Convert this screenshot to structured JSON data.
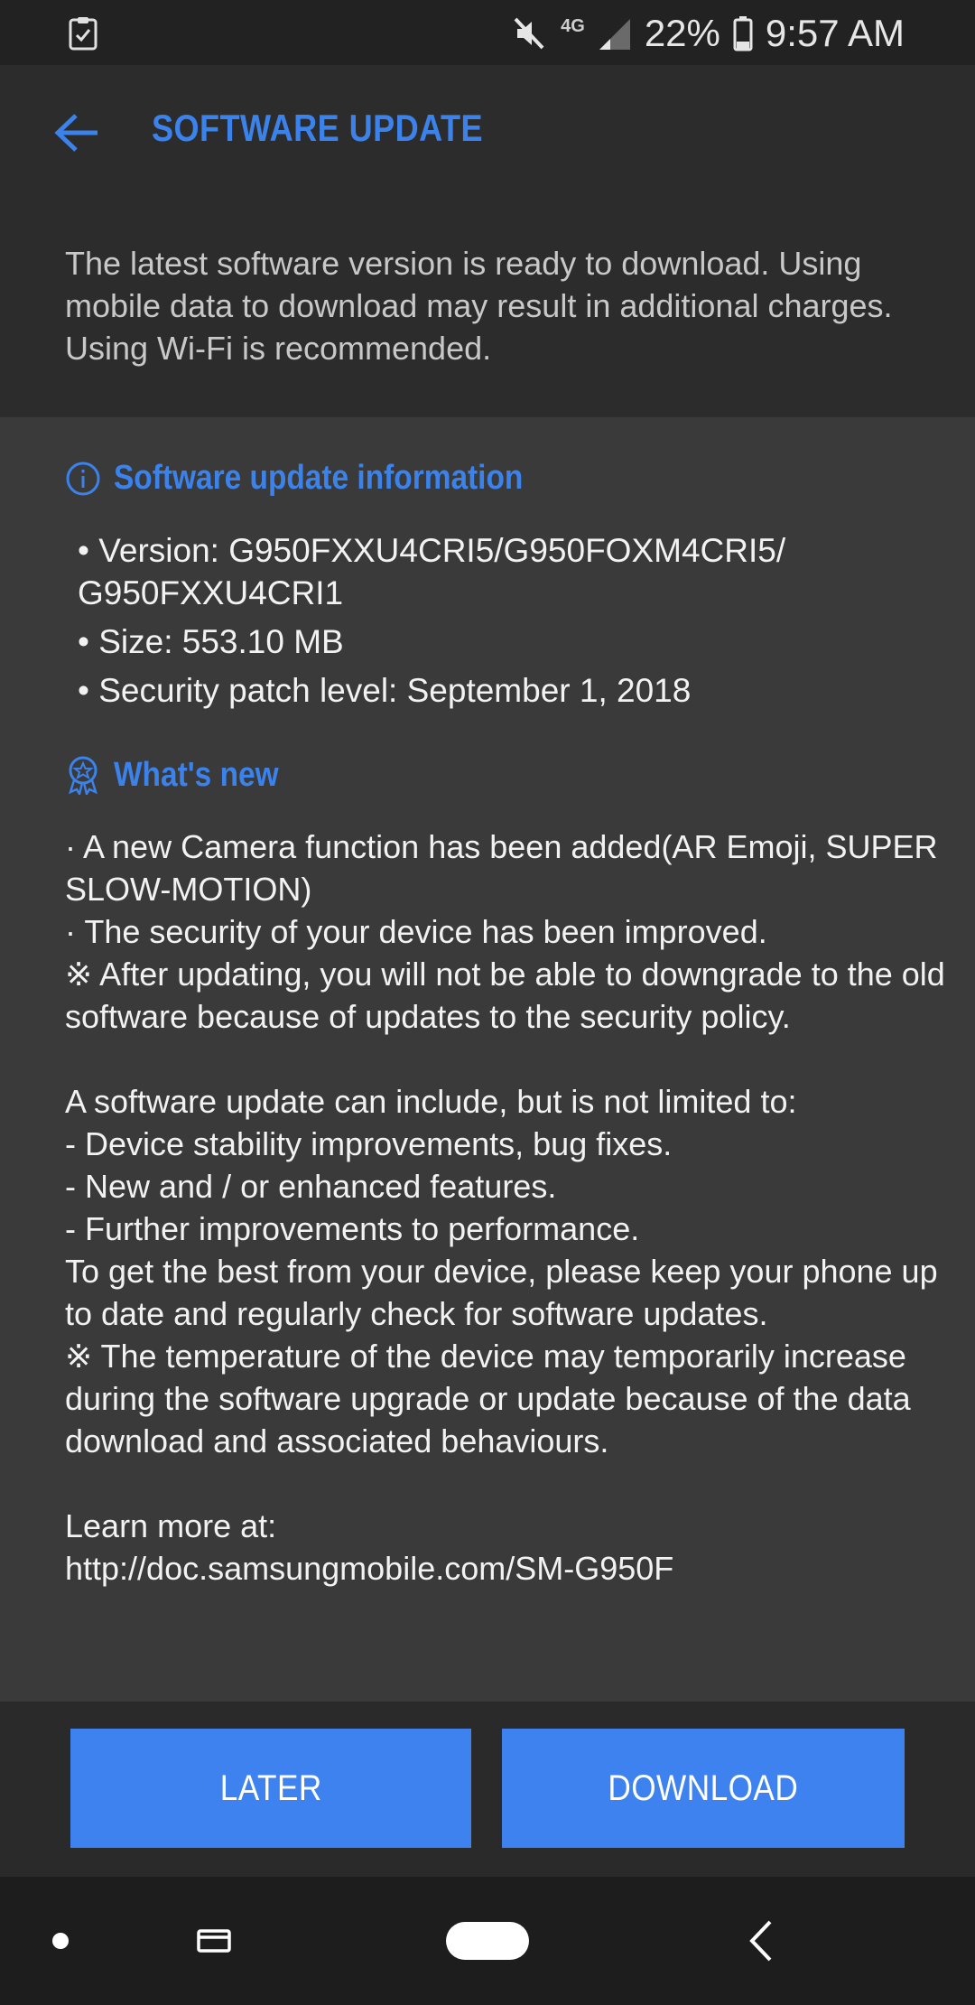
{
  "status_bar": {
    "left_icon": "clipboard-check-icon",
    "network_label": "4G",
    "battery_text": "22%",
    "time": "9:57 AM"
  },
  "header": {
    "title": "SOFTWARE UPDATE",
    "intro": "The latest software version is ready to download. Using mobile data to download may result in additional charges. Using Wi-Fi is recommended."
  },
  "info_section": {
    "title": "Software update information",
    "items": [
      "• Version: G950FXXU4CRI5/G950FOXM4CRI5/ G950FXXU4CRI1",
      "• Size: 553.10 MB",
      "• Security patch level: September 1, 2018"
    ]
  },
  "whats_new": {
    "title": "What's new",
    "body": "· A new Camera function has been added(AR Emoji, SUPER SLOW-MOTION)\n· The security of your device has been improved.\n※ After updating, you will not be able to downgrade to the old software because of updates to the security policy.\n\nA software update can include, but is not limited to:\n - Device stability improvements, bug fixes.\n - New and / or enhanced features.\n - Further improvements to performance.\nTo get the best from your device, please keep your phone up to date and regularly check for software updates.\n※ The temperature of the device may temporarily increase during the software upgrade or update because of the data download and associated behaviours.\n\nLearn more at:\nhttp://doc.samsungmobile.com/SM-G950F"
  },
  "actions": {
    "later_label": "LATER",
    "download_label": "DOWNLOAD"
  },
  "colors": {
    "accent": "#3b82ea",
    "button": "#3d82ee"
  }
}
